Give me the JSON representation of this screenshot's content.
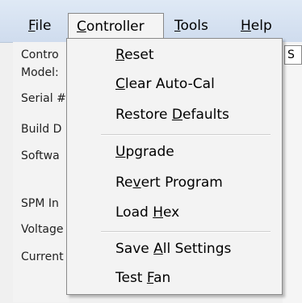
{
  "menubar": {
    "file": {
      "pre": "",
      "acc": "F",
      "post": "ile"
    },
    "controller": {
      "pre": "",
      "acc": "C",
      "post": "ontroller"
    },
    "tools": {
      "pre": "",
      "acc": "T",
      "post": "ools"
    },
    "help": {
      "pre": "",
      "acc": "H",
      "post": "elp"
    }
  },
  "side_labels": [
    "Contro",
    "Model:",
    "Serial #",
    "Build D",
    "Softwa",
    "SPM In",
    "Voltage",
    "Current"
  ],
  "right_tab": "S",
  "controller_menu": [
    {
      "pre": "",
      "acc": "R",
      "post": "eset"
    },
    {
      "pre": "",
      "acc": "C",
      "post": "lear Auto-Cal"
    },
    {
      "pre": "Restore ",
      "acc": "D",
      "post": "efaults"
    },
    {
      "pre": "",
      "acc": "U",
      "post": "pgrade"
    },
    {
      "pre": "Re",
      "acc": "v",
      "post": "ert Program"
    },
    {
      "pre": "Load ",
      "acc": "H",
      "post": "ex"
    },
    {
      "pre": "Save ",
      "acc": "A",
      "post": "ll Settings"
    },
    {
      "pre": "Test ",
      "acc": "F",
      "post": "an"
    }
  ],
  "colors": {
    "menubar": "#d6e2f2",
    "menu_bg": "#f3f3f3",
    "separator": "#cfcfcf"
  }
}
